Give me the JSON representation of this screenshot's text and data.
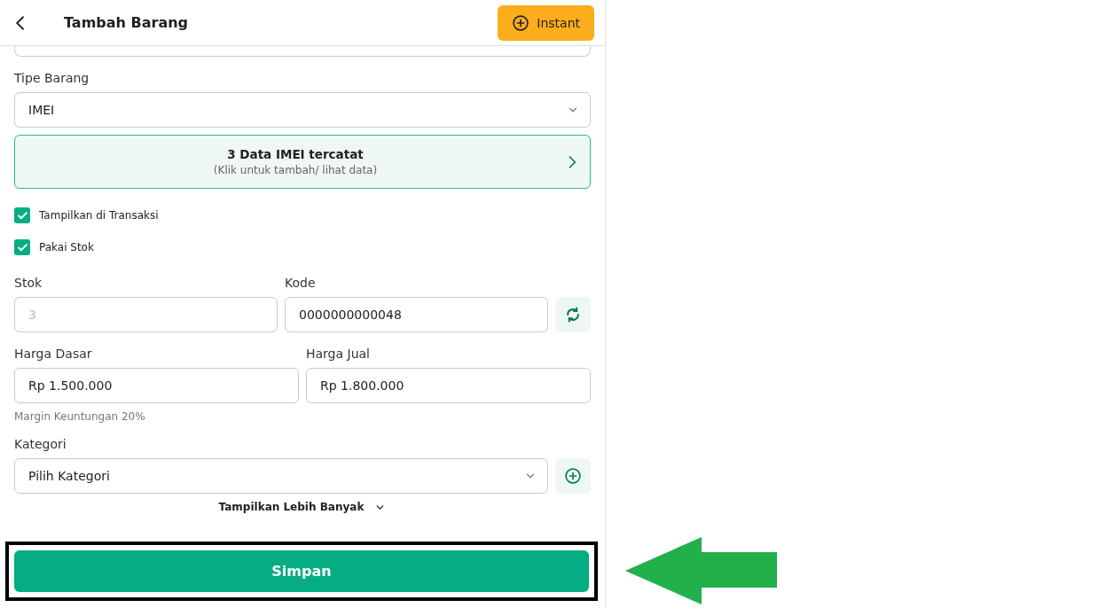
{
  "header": {
    "title": "Tambah Barang",
    "action": "Instant"
  },
  "item_type": {
    "label": "Tipe Barang",
    "value": "IMEI"
  },
  "imei_card": {
    "title": "3 Data IMEI tercatat",
    "subtitle": "(Klik untuk tambah/ lihat data)"
  },
  "checkboxes": [
    {
      "label": "Tampilkan di Transaksi",
      "checked": true
    },
    {
      "label": "Pakai Stok",
      "checked": true
    }
  ],
  "stock": {
    "label": "Stok",
    "placeholder": "3"
  },
  "code": {
    "label": "Kode",
    "value": "0000000000048"
  },
  "base_price": {
    "label": "Harga Dasar",
    "value": "Rp 1.500.000"
  },
  "sell_price": {
    "label": "Harga Jual",
    "value": "Rp 1.800.000"
  },
  "margin": "Margin Keuntungan 20%",
  "category": {
    "label": "Kategori",
    "placeholder": "Pilih Kategori"
  },
  "show_more": "Tampilkan Lebih Banyak",
  "save_button": {
    "label": "Simpan",
    "highlighted": true
  }
}
